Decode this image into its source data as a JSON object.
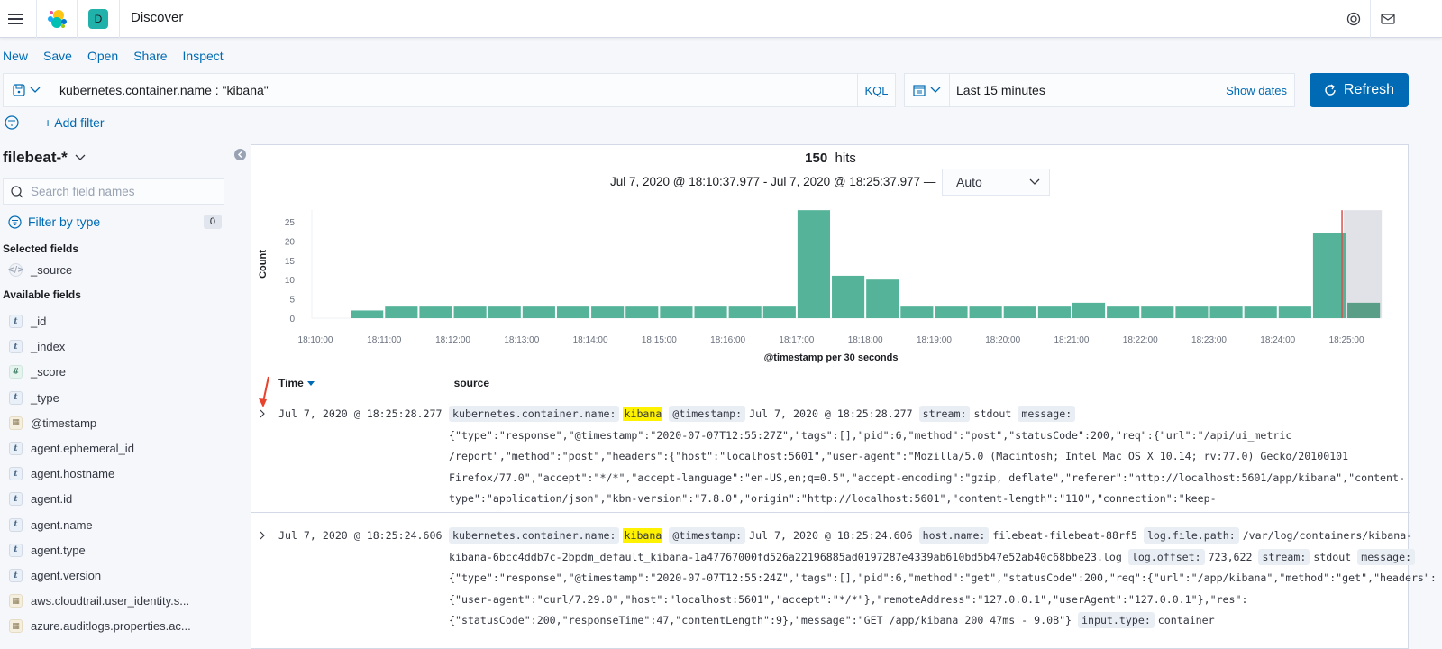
{
  "header": {
    "app_title": "Discover",
    "space_initial": "D",
    "icons": [
      "menu-icon",
      "elastic-logo",
      "help-icon",
      "mail-icon"
    ]
  },
  "toolbar": {
    "links": [
      "New",
      "Save",
      "Open",
      "Share",
      "Inspect"
    ]
  },
  "query": {
    "value": "kubernetes.container.name : \"kibana\"",
    "language": "KQL"
  },
  "time": {
    "range": "Last 15 minutes",
    "show_dates": "Show dates",
    "refresh": "Refresh"
  },
  "filters": {
    "add": "+ Add filter"
  },
  "sidebar": {
    "index_pattern": "filebeat-*",
    "search_placeholder": "Search field names",
    "filter_by_type": "Filter by type",
    "filter_count": "0",
    "selected_heading": "Selected fields",
    "selected": [
      {
        "name": "_source",
        "type": "source"
      }
    ],
    "available_heading": "Available fields",
    "available": [
      {
        "name": "_id",
        "type": "t"
      },
      {
        "name": "_index",
        "type": "t"
      },
      {
        "name": "_score",
        "type": "#"
      },
      {
        "name": "_type",
        "type": "t"
      },
      {
        "name": "@timestamp",
        "type": "date"
      },
      {
        "name": "agent.ephemeral_id",
        "type": "t"
      },
      {
        "name": "agent.hostname",
        "type": "t"
      },
      {
        "name": "agent.id",
        "type": "t"
      },
      {
        "name": "agent.name",
        "type": "t"
      },
      {
        "name": "agent.type",
        "type": "t"
      },
      {
        "name": "agent.version",
        "type": "t"
      },
      {
        "name": "aws.cloudtrail.user_identity.s...",
        "type": "date"
      },
      {
        "name": "azure.auditlogs.properties.ac...",
        "type": "date"
      }
    ]
  },
  "hits": {
    "count": "150",
    "label": "hits",
    "range": "Jul 7, 2020 @ 18:10:37.977 - Jul 7, 2020 @ 18:25:37.977 —",
    "interval": "Auto"
  },
  "chart_data": {
    "type": "bar",
    "xlabel": "@timestamp per 30 seconds",
    "ylabel": "Count",
    "ylim": [
      0,
      28
    ],
    "yticks": [
      "0",
      "5",
      "10",
      "15",
      "20",
      "25"
    ],
    "xticks": [
      "18:10:00",
      "18:11:00",
      "18:12:00",
      "18:13:00",
      "18:14:00",
      "18:15:00",
      "18:16:00",
      "18:17:00",
      "18:18:00",
      "18:19:00",
      "18:20:00",
      "18:21:00",
      "18:22:00",
      "18:23:00",
      "18:24:00",
      "18:25:00"
    ],
    "bar_color": "#54b399",
    "partial_color": "#5a9e88",
    "categories": [
      "18:10:00",
      "18:10:30",
      "18:11:00",
      "18:11:30",
      "18:12:00",
      "18:12:30",
      "18:13:00",
      "18:13:30",
      "18:14:00",
      "18:14:30",
      "18:15:00",
      "18:15:30",
      "18:16:00",
      "18:16:30",
      "18:17:00",
      "18:17:30",
      "18:18:00",
      "18:18:30",
      "18:19:00",
      "18:19:30",
      "18:20:00",
      "18:20:30",
      "18:21:00",
      "18:21:30",
      "18:22:00",
      "18:22:30",
      "18:23:00",
      "18:23:30",
      "18:24:00",
      "18:24:30",
      "18:25:00"
    ],
    "values": [
      0,
      2,
      3,
      3,
      3,
      3,
      3,
      3,
      3,
      3,
      3,
      3,
      3,
      3,
      28,
      11,
      10,
      3,
      3,
      3,
      3,
      3,
      4,
      3,
      3,
      3,
      3,
      3,
      3,
      22,
      4
    ]
  },
  "table": {
    "columns": [
      "Time",
      "_source"
    ],
    "rows": [
      {
        "time": "Jul 7, 2020 @ 18:25:28.277",
        "lines": [
          [
            {
              "k": "kubernetes.container.name:"
            },
            {
              "h": "kibana"
            },
            {
              "k": "@timestamp:"
            },
            {
              "t": "Jul 7, 2020 @ 18:25:28.277 "
            },
            {
              "k": "stream:"
            },
            {
              "t": "stdout "
            },
            {
              "k": "message:"
            }
          ],
          [
            {
              "t": "{\"type\":\"response\",\"@timestamp\":\"2020-07-07T12:55:27Z\",\"tags\":[],\"pid\":6,\"method\":\"post\",\"statusCode\":200,\"req\":{\"url\":\"/api/ui_metric"
            }
          ],
          [
            {
              "t": "/report\",\"method\":\"post\",\"headers\":{\"host\":\"localhost:5601\",\"user-agent\":\"Mozilla/5.0 (Macintosh; Intel Mac OS X 10.14; rv:77.0) Gecko/20100101"
            }
          ],
          [
            {
              "t": "Firefox/77.0\",\"accept\":\"*/*\",\"accept-language\":\"en-US,en;q=0.5\",\"accept-encoding\":\"gzip, deflate\",\"referer\":\"http://localhost:5601/app/kibana\",\"content-"
            }
          ],
          [
            {
              "t": "type\":\"application/json\",\"kbn-version\":\"7.8.0\",\"origin\":\"http://localhost:5601\",\"content-length\":\"110\",\"connection\":\"keep-"
            }
          ]
        ]
      },
      {
        "time": "Jul 7, 2020 @ 18:25:24.606",
        "lines": [
          [
            {
              "k": "kubernetes.container.name:"
            },
            {
              "h": "kibana"
            },
            {
              "k": "@timestamp:"
            },
            {
              "t": "Jul 7, 2020 @ 18:25:24.606 "
            },
            {
              "k": "host.name:"
            },
            {
              "t": "filebeat-filebeat-88rf5 "
            },
            {
              "k": "log.file.path:"
            },
            {
              "t": "/var/log/containers/kibana-"
            }
          ],
          [
            {
              "t": "kibana-6bcc4ddb7c-2bpdm_default_kibana-1a47767000fd526a22196885ad0197287e4339ab610bd5b47e52ab40c68bbe23.log "
            },
            {
              "k": "log.offset:"
            },
            {
              "t": "723,622 "
            },
            {
              "k": "stream:"
            },
            {
              "t": "stdout "
            },
            {
              "k": "message:"
            }
          ],
          [
            {
              "t": "{\"type\":\"response\",\"@timestamp\":\"2020-07-07T12:55:24Z\",\"tags\":[],\"pid\":6,\"method\":\"get\",\"statusCode\":200,\"req\":{\"url\":\"/app/kibana\",\"method\":\"get\",\"headers\":"
            }
          ],
          [
            {
              "t": "{\"user-agent\":\"curl/7.29.0\",\"host\":\"localhost:5601\",\"accept\":\"*/*\"},\"remoteAddress\":\"127.0.0.1\",\"userAgent\":\"127.0.0.1\"},\"res\":"
            }
          ],
          [
            {
              "t": "{\"statusCode\":200,\"responseTime\":47,\"contentLength\":9},\"message\":\"GET /app/kibana 200 47ms - 9.0B\"} "
            },
            {
              "k": "input.type:"
            },
            {
              "t": "container"
            }
          ]
        ]
      }
    ]
  }
}
